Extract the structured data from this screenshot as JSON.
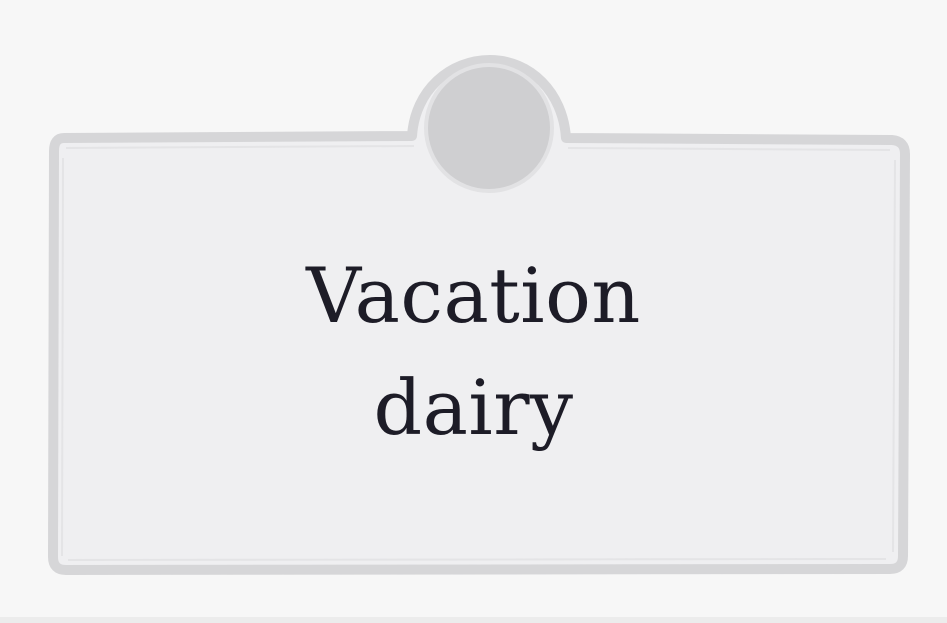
{
  "label": {
    "title_line_1": "Vacation",
    "title_line_2": "dairy"
  },
  "colors": {
    "background": "#f7f7f7",
    "card_fill": "#efeff1",
    "card_border": "#d6d6d8",
    "tab_circle": "#cfcfd1",
    "text": "#1d1c27"
  }
}
